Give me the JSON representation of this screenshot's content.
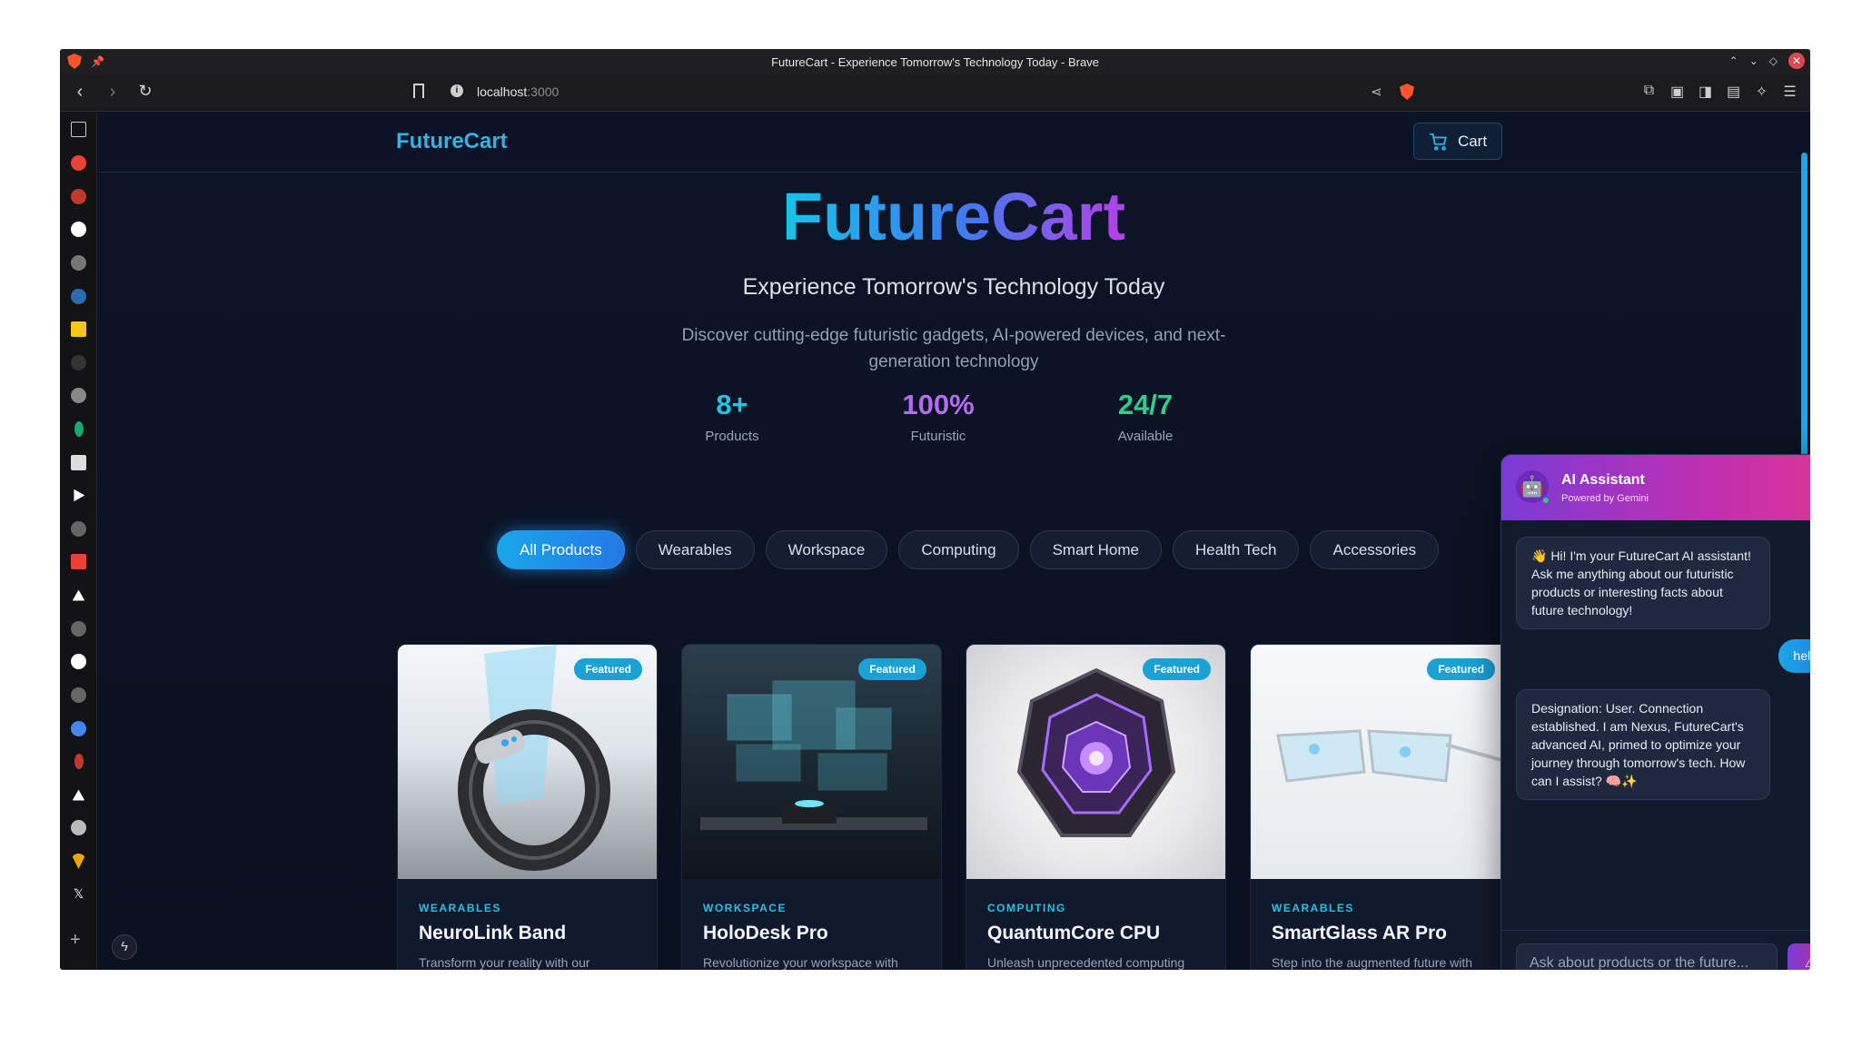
{
  "browser": {
    "window_title": "FutureCart - Experience Tomorrow's Technology Today - Brave",
    "url_host": "localhost",
    "url_port": ":3000"
  },
  "nav": {
    "brand": "FutureCart",
    "cart_label": "Cart"
  },
  "hero": {
    "title": "FutureCart",
    "subtitle": "Experience Tomorrow's Technology Today",
    "description": "Discover cutting-edge futuristic gadgets, AI-powered devices, and next-generation technology"
  },
  "stats": [
    {
      "value": "8+",
      "label": "Products",
      "color": "#22c3e6"
    },
    {
      "value": "100%",
      "label": "Futuristic",
      "color": "#b56cf0"
    },
    {
      "value": "24/7",
      "label": "Available",
      "color": "#2ecf8e"
    }
  ],
  "filters": [
    "All Products",
    "Wearables",
    "Workspace",
    "Computing",
    "Smart Home",
    "Health Tech",
    "Accessories"
  ],
  "active_filter": "All Products",
  "products": [
    {
      "badge": "Featured",
      "category": "WEARABLES",
      "name": "NeuroLink Band",
      "description": "Transform your reality with our"
    },
    {
      "badge": "Featured",
      "category": "WORKSPACE",
      "name": "HoloDesk Pro",
      "description": "Revolutionize your workspace with"
    },
    {
      "badge": "Featured",
      "category": "COMPUTING",
      "name": "QuantumCore CPU",
      "description": "Unleash unprecedented computing"
    },
    {
      "badge": "Featured",
      "category": "WEARABLES",
      "name": "SmartGlass AR Pro",
      "description": "Step into the augmented future with"
    }
  ],
  "chat": {
    "title": "AI Assistant",
    "subtitle": "Powered by Gemini",
    "messages": [
      {
        "role": "bot",
        "text": "👋 Hi! I'm your FutureCart AI assistant! Ask me anything about our futuristic products or interesting facts about future technology!"
      },
      {
        "role": "user",
        "text": "hello"
      },
      {
        "role": "bot",
        "text": "Designation: User. Connection established. I am Nexus, FutureCart's advanced AI, primed to optimize your journey through tomorrow's tech. How can I assist? 🧠✨"
      }
    ],
    "input_placeholder": "Ask about products or the future...",
    "send_icon": "⚠"
  }
}
